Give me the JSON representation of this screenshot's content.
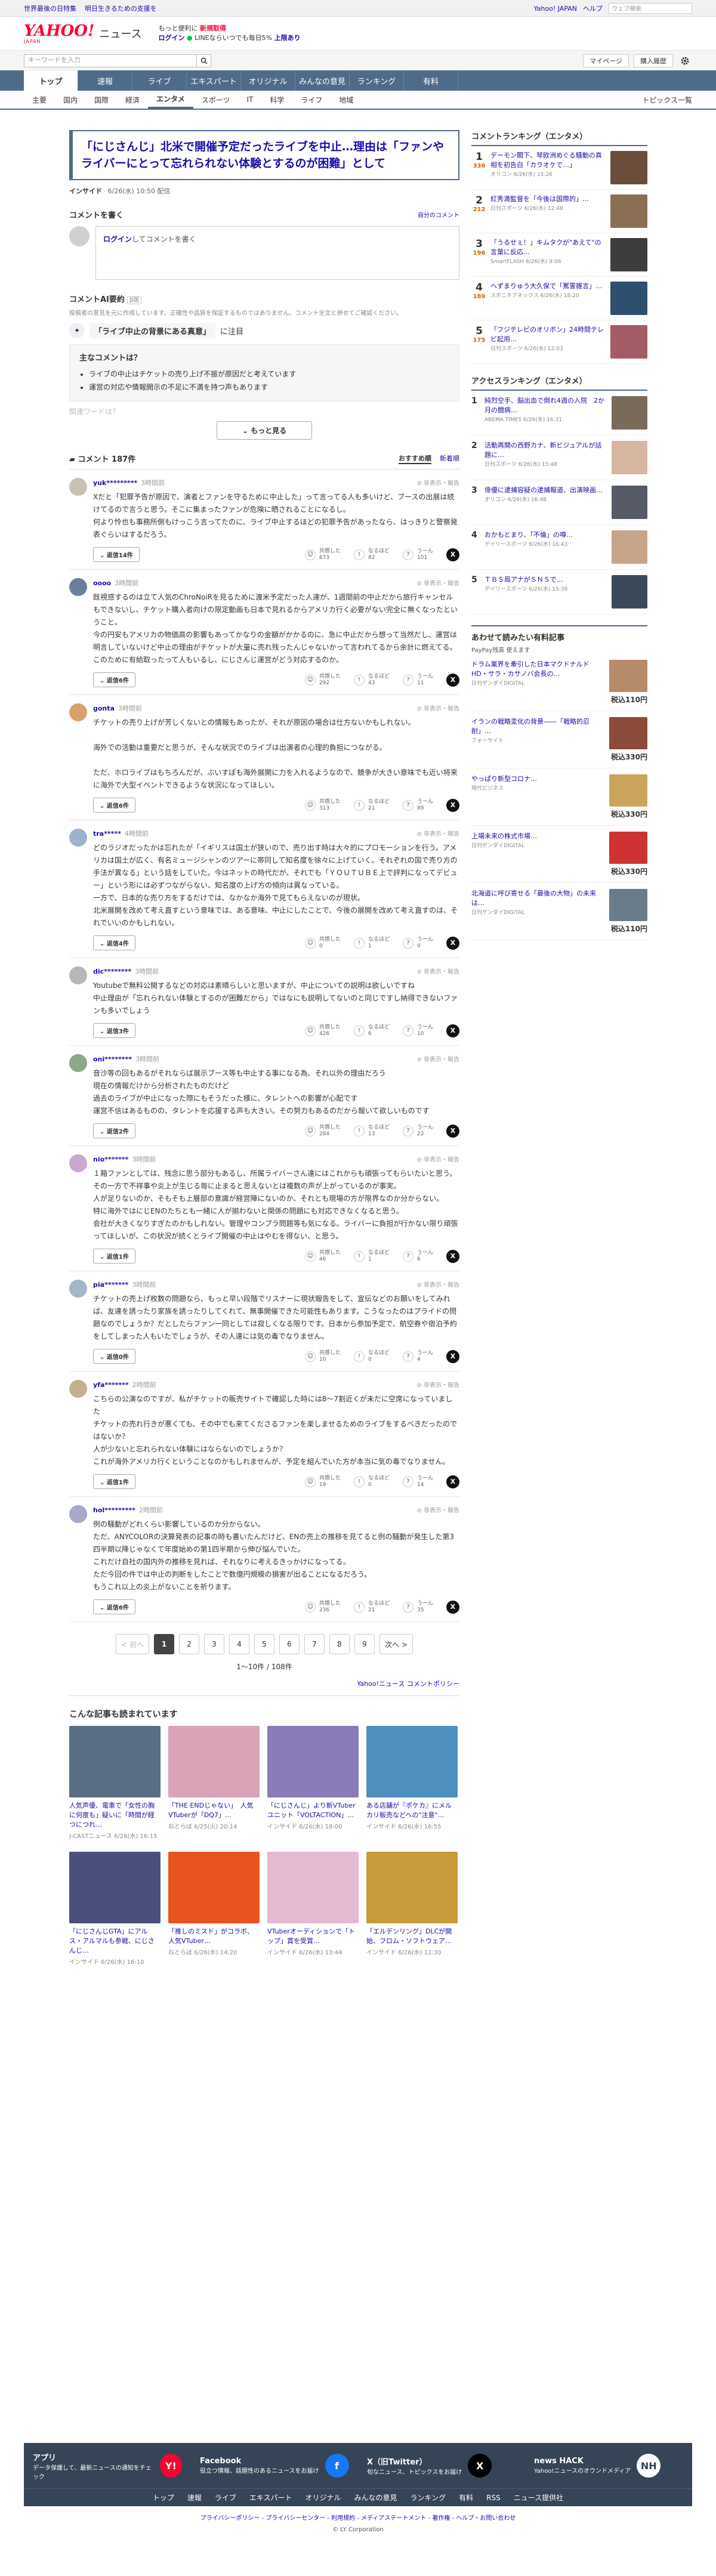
{
  "topbar": {
    "links": [
      "世界最後の日特集",
      "明日生きるための支援を"
    ],
    "yahoo_link": "Yahoo! JAPAN",
    "help_link": "ヘルプ",
    "search_placeholder": "ウェブ検索"
  },
  "header": {
    "logo": "YAHOO!",
    "logo_sub": "JAPAN",
    "service": "ニュース",
    "promo_line1": "もっと便利に",
    "promo_new": "新規取得",
    "promo_login": "ログイン",
    "promo_line2": "LINEならいつでも毎日5%",
    "promo_line2b": "上限あり"
  },
  "searchrow": {
    "placeholder": "キーワードを入力",
    "mypage": "マイページ",
    "purchase": "購入履歴"
  },
  "gnav": [
    "トップ",
    "速報",
    "ライブ",
    "エキスパート",
    "オリジナル",
    "みんなの意見",
    "ランキング",
    "有料"
  ],
  "snav": {
    "items": [
      "主要",
      "国内",
      "国際",
      "経済",
      "エンタメ",
      "スポーツ",
      "IT",
      "科学",
      "ライフ",
      "地域"
    ],
    "active": 4,
    "topics": "トピックス一覧"
  },
  "article": {
    "title": "「にじさんじ」北米で開催予定だったライブを中止…理由は「ファンやライバーにとって忘れられない体験とするのが困難」として",
    "source": "インサイド",
    "date": "6/26(水) 10:50 配信"
  },
  "compose": {
    "heading": "コメントを書く",
    "link": "自分のコメント",
    "login": "ログイン",
    "prompt": "してコメントを書く"
  },
  "ai": {
    "heading": "コメントAI要約",
    "badge": "β版",
    "note": "投稿者の意見を元に作成しています。正確性や品質を保証するものではありません。コメント全文と併せてご確認ください。",
    "question": "「ライブ中止の背景にある真意」",
    "question_suffix": "に注目",
    "box_title": "主なコメントは？",
    "points": [
      "ライブの中止はチケットの売り上げ不振が原因だと考えています",
      "運営の対応や情報開示の不足に不満を持つ声もあります"
    ],
    "fade": "関連ワードは？",
    "more": "もっと見る"
  },
  "comments_header": {
    "title": "コメント 187件",
    "sort_recommended": "おすすめ順",
    "sort_new": "新着順"
  },
  "comments": [
    {
      "name": "yuk*********",
      "time": "3時間前",
      "report": "非表示・報告",
      "text": "Xだと「犯罪予告が原因で、演者とファンを守るために中止した」って言ってる人も多いけど、ブースの出展は続けてるので言うと思う。そこに集まったファンが危険に晒されることになるし。\n何より怜也も事務所側もけっこう言ってたのに、ライブ中止するほどの犯罪予告があったなら、はっきりと警察発表ぐらいはするだろう。",
      "replies": "返信14件",
      "empathy": "673",
      "insight": "82",
      "hmm": "101"
    },
    {
      "name": "oooo",
      "time": "3時間前",
      "report": "非表示・報告",
      "text": "既視感するのは立て人気のChroNoiRを見るために渡米予定だった人達が、1週間前の中止だから旅行キャンセルもできないし、チケット購入者向けの限定動画も日本で見れるからアメリカ行く必要がない完全に無くなったということ。\n今の円安もアメリカの物価高の影響もあってかなりの金額がかかるのに、急に中止だから想って当然だし、運営は明言していないけど中止の理由がチケットが大量に売れ残ったんじゃないかって言われてるから余計に燃えてる。\nこのために有給取ったって人もいるし、にじさんじ運営がどう対応するのか。",
      "replies": "返信6件",
      "empathy": "292",
      "insight": "43",
      "hmm": "11"
    },
    {
      "name": "gonta",
      "time": "3時間前",
      "report": "非表示・報告",
      "text": "チケットの売り上げが芳しくないとの情報もあったが、それが原因の場合は仕方ないかもしれない。\n\n海外での活動は重要だと思うが、そんな状況でのライブは出演者の心理的負担につながる。\n\nただ、ホロライブはもちろんだが、ぶいすぽも海外展開に力を入れるようなので、競争が大きい意味でも近い将来に海外で大型イベントできるような状況になってほしい。",
      "replies": "返信6件",
      "empathy": "313",
      "insight": "21",
      "hmm": "89"
    },
    {
      "name": "tra*****",
      "time": "4時間前",
      "report": "非表示・報告",
      "text": "どのラジオだったかは忘れたが「イギリスは国土が狭いので、売り出す時は大々的にプロモーションを行う。アメリカは国土が広く、有名ミュージシャンのツアーに帯同して知名度を徐々に上げていく。それぞれの国で売り方の手法が異なる」という話をしていた。今はネットの時代だが、それでも「ＹＯＵＴＵＢＥ上で評判になってデビュー」という形には必ずつながらない、知名度の上げ方の傾向は異なっている。\n一方で、日本的な売り方をするだけでは、なかなか海外で見てもらえないのが現状。\n北米展開を改めて考え直すという意味では、ある意味、中止にしたことで、今後の展開を改めて考え直すのは、それでいいのかもしれない。",
      "replies": "返信4件",
      "empathy": "0",
      "insight": "1",
      "hmm": "0"
    },
    {
      "name": "dic********",
      "time": "3時間前",
      "report": "非表示・報告",
      "text": "Youtubeで無料公開するなどの対応は素晴らしいと思いますが、中止についての説明は欲しいですね\n中止理由が「忘れられない体験とするのが困難だから」ではなにも説明してないのと同じですし納得できないファンも多いでしょう",
      "replies": "返信3件",
      "empathy": "426",
      "insight": "6",
      "hmm": "10"
    },
    {
      "name": "oni********",
      "time": "3時間前",
      "report": "非表示・報告",
      "text": "音沙等の回もあるがそれならば展示ブース等も中止する事になる為、それ以外の理由だろう\n現在の情報だけから分析されたものだけど\n過去のライブが中止になった際にもそうだった様に、タレントへの影響が心配です\n運営不信はあるものの、タレントを応援する声も大きい。その努力もあるのだから報いて欲しいものです",
      "replies": "返信2件",
      "empathy": "284",
      "insight": "13",
      "hmm": "22"
    },
    {
      "name": "nio*******",
      "time": "3時間前",
      "report": "非表示・報告",
      "text": "１箱ファンとしては、残念に思う部分もあるし、所属ライバーさん達にはこれからも頑張ってもらいたいと思う。\nその一方で不祥事や炎上が生じる毎に止まると思えないとは複数の声が上がっているのが事実。\n人が足りないのか、そもそも上層部の意識が経営陣にないのか、それとも現場の方が限界なのか分からない。\n特に海外ではにじENのたちとも一緒に人が揃わないと関係の問題にも対応できなくなると思う。\n会社が大きくなりすぎたのかもしれない。管理やコンプラ問題等も気になる。ライバーに負担が行かない限り頑張ってほしいが、この状況が続くとライブ開催の中止はやむを得ない、と思う。",
      "replies": "返信1件",
      "empathy": "46",
      "insight": "1",
      "hmm": "6"
    },
    {
      "name": "pia*******",
      "time": "3時間前",
      "report": "非表示・報告",
      "text": "チケットの売上げ枚数の問題なら、もっと早い段階でリスナーに現状報告をして、宣伝などのお願いをしてみれば、友達を誘ったり家族を誘ったりしてくれて、無事開催できた可能性もあります。こうなったのはプライドの問題なのでしょうか？だとしたらファン一同としては寂しくなる限りです。日本から参加予定で、航空券や宿泊予約をしてしまった人もいたでしょうが、その人達には気の毒でなりません。",
      "replies": "返信0件",
      "empathy": "10",
      "insight": "0",
      "hmm": "4"
    },
    {
      "name": "yfa*******",
      "time": "2時間前",
      "report": "非表示・報告",
      "text": "こちらの公演なのですが、私がチケットの販売サイトで確認した時には8〜7割近くが未だに空席になっていました\nチケットの売れ行きが悪くても、その中でも来てくださるファンを楽しませるためのライブをするべきだったのではないか？\n人が少ないと忘れられない体験にはならないのでしょうか？\nこれが海外アメリカ行くということなのかもしれませんが、予定を組んでいた方が本当に気の毒でなりません。",
      "replies": "返信1件",
      "empathy": "19",
      "insight": "0",
      "hmm": "14"
    },
    {
      "name": "hol*********",
      "time": "2時間前",
      "report": "非表示・報告",
      "text": "例の騒動がどれくらい影響しているのか分からない。\nただ、ANYCOLORの決算発表の記事の時も書いたんだけど、ENの売上の推移を見てると例の騒動が発生した第3四半期以降じゃなくて年度始めの第1四半期から伸び悩んでいた。\nこれだけ自社の国内外の推移を見れば、それなりに考えるきっかけになってる。\nただ今回の件では中止の判断をしたことで数億円規模の損害が出ることになるだろう。\nもうこれ以上の炎上がないことを祈ります。",
      "replies": "返信6件",
      "empathy": "236",
      "insight": "21",
      "hmm": "35"
    }
  ],
  "reaction_labels": {
    "empathy": "共感した",
    "insight": "なるほど",
    "hmm": "うーん"
  },
  "pager": {
    "prev": "前へ",
    "pages": [
      "1",
      "2",
      "3",
      "4",
      "5",
      "6",
      "7",
      "8",
      "9"
    ],
    "next": "次へ",
    "count": "1〜10件 / 108件",
    "policy": "Yahoo!ニュース コメントポリシー"
  },
  "recommended": {
    "heading": "こんな記事も読まれています",
    "items": [
      {
        "title": "人気声優、電車で「女性の胸に何度も」疑いに「時間が経つにつれ…",
        "source": "J-CASTニュース",
        "date": "6/26(水) 16:15",
        "color": "#5a6e84"
      },
      {
        "title": "「THE ENDじゃない」　人気VTuberが「DQ7」…",
        "source": "ねとらぼ",
        "date": "6/25(火) 20:14",
        "color": "#d9a2b6"
      },
      {
        "title": "「にじさんじ」より新VTuberユニット「VOLTACTION」…",
        "source": "インサイド",
        "date": "6/26(水) 18:00",
        "color": "#8a7bb8"
      },
      {
        "title": "ある店舗が『ポケカ』にメルカリ販売などへの\"注意\"…",
        "source": "インサイド",
        "date": "6/26(水) 16:55",
        "color": "#4e8fbf"
      },
      {
        "title": "「にじさんじGTA」にアルス・アルマルも参戦、にじさんじ…",
        "source": "インサイド",
        "date": "6/26(水) 16:10",
        "color": "#4b4f7c"
      },
      {
        "title": "「推しのミスド」がコラボ、人気VTuber…",
        "source": "ねとらぼ",
        "date": "6/26(水) 14:20",
        "color": "#e9541e"
      },
      {
        "title": "VTuberオーディションで「トップ」賞を受賞…",
        "source": "インサイド",
        "date": "6/26(水) 13:44",
        "color": "#e4b9d2"
      },
      {
        "title": "「エルデンリング」DLCが開始、フロム・ソフトウェア…",
        "source": "インサイド",
        "date": "6/26(水) 12:30",
        "color": "#c79a3a"
      }
    ]
  },
  "side": {
    "comment_ranking": {
      "heading": "コメントランキング（エンタメ）",
      "items": [
        {
          "rank": "1",
          "count": "336",
          "title": "デーモン閣下、琴欧洲めぐる騒動の真相を初告白「カラオケで…」",
          "source": "オリコン",
          "date": "6/26(水) 15:26",
          "color": "#6a4d3a"
        },
        {
          "rank": "2",
          "count": "212",
          "title": "紅秀満監督を「今後は国際的」…",
          "source": "日刊スポーツ",
          "date": "6/26(水) 12:48",
          "color": "#8b6f55"
        },
        {
          "rank": "3",
          "count": "196",
          "title": "「うるせぇ！」キムタクが\"あえて\"の言葉に反応…",
          "source": "SmartFLASH",
          "date": "6/26(水) 9:06",
          "color": "#3d3d3d"
        },
        {
          "rank": "4",
          "count": "189",
          "title": "へずまりゅう大久保で「罵詈雑言」…",
          "source": "スポニチアネックス",
          "date": "6/26(水) 18:20",
          "color": "#2f4f6f"
        },
        {
          "rank": "5",
          "count": "175",
          "title": "「フジテレビのオリボン」24時間テレビ起用…",
          "source": "日刊スポーツ",
          "date": "6/26(水) 12:03",
          "color": "#a35b66"
        }
      ]
    },
    "access_ranking": {
      "heading": "アクセスランキング（エンタメ）",
      "items": [
        {
          "rank": "1",
          "title": "純烈空手、脳出血で倒れ4週の入院　2か月の闘病…",
          "source": "ABEMA TIMES",
          "date": "6/26(水) 16:31",
          "color": "#7a6a5a"
        },
        {
          "rank": "2",
          "title": "活動再開の西野カナ、新ビジュアルが話題に…",
          "source": "日刊スポーツ",
          "date": "6/26(水) 15:48",
          "color": "#d7b7a1"
        },
        {
          "rank": "3",
          "title": "俳優に逮捕容疑の逮捕報道、出演映画…",
          "source": "オリコン",
          "date": "6/26(水) 16:48",
          "color": "#555a66"
        },
        {
          "rank": "4",
          "title": "おかもとまり、「不倫」の噂…",
          "source": "デイリースポーツ",
          "date": "6/26(水) 16:43",
          "color": "#c6a48a"
        },
        {
          "rank": "5",
          "title": "ＴＢＳ局アナがＳＮＳで…",
          "source": "デイリースポーツ",
          "date": "6/26(水) 15:39",
          "color": "#3a4a5a"
        }
      ]
    },
    "paid": {
      "heading": "あわせて読みたい有料記事",
      "sub": "PayPay残高 使えます",
      "items": [
        {
          "title": "ドラム業界を牽引した日本マクドナルドHD・サラ・カサノバ会長の…",
          "source": "日刊ゲンダイDIGITAL",
          "price": "税込110円",
          "color": "#b68b6a"
        },
        {
          "title": "イランの戦略変化の背景――「戦略的忍耐」…",
          "source": "フォーサイト",
          "price": "税込330円",
          "color": "#8a4b3a"
        },
        {
          "title": "やっぱり新型コロナ…",
          "source": "現代ビジネス",
          "price": "税込330円",
          "color": "#caa45a"
        },
        {
          "title": "上場未来の株式市場…",
          "source": "日刊ゲンダイDIGITAL",
          "price": "税込330円",
          "color": "#cc3333"
        },
        {
          "title": "北海道に呼び寄せる「最後の大物」の未来は…",
          "source": "日刊ゲンダイDIGITAL",
          "price": "税込110円",
          "color": "#6a7c8a"
        }
      ]
    }
  },
  "footer": {
    "apps": [
      {
        "title": "アプリ",
        "desc": "データ保護して、最新ニュースの通知をチェック",
        "icon": "Y!",
        "color": "#ff0033"
      },
      {
        "title": "Facebook",
        "desc": "役立つ情報、話題性のあるニュースをお届け",
        "icon": "f",
        "color": "#1877f2"
      },
      {
        "title": "X（旧Twitter）",
        "desc": "旬なニュース、トピックスをお届け",
        "icon": "X",
        "color": "#000000"
      },
      {
        "title": "news HACK",
        "desc": "Yahoo!ニュースのオウンドメディア",
        "icon": "NH",
        "color": "#ffffff"
      }
    ],
    "nav": [
      "トップ",
      "速報",
      "ライブ",
      "エキスパート",
      "オリジナル",
      "みんなの意見",
      "ランキング",
      "有料",
      "RSS",
      "ニュース提供社"
    ],
    "links": "プライバシーポリシー - プライバシーセンター - 利用規約 - メディアステートメント - 著作権 - ヘルプ・お問い合わせ",
    "copyright": "© LY Corporation"
  }
}
